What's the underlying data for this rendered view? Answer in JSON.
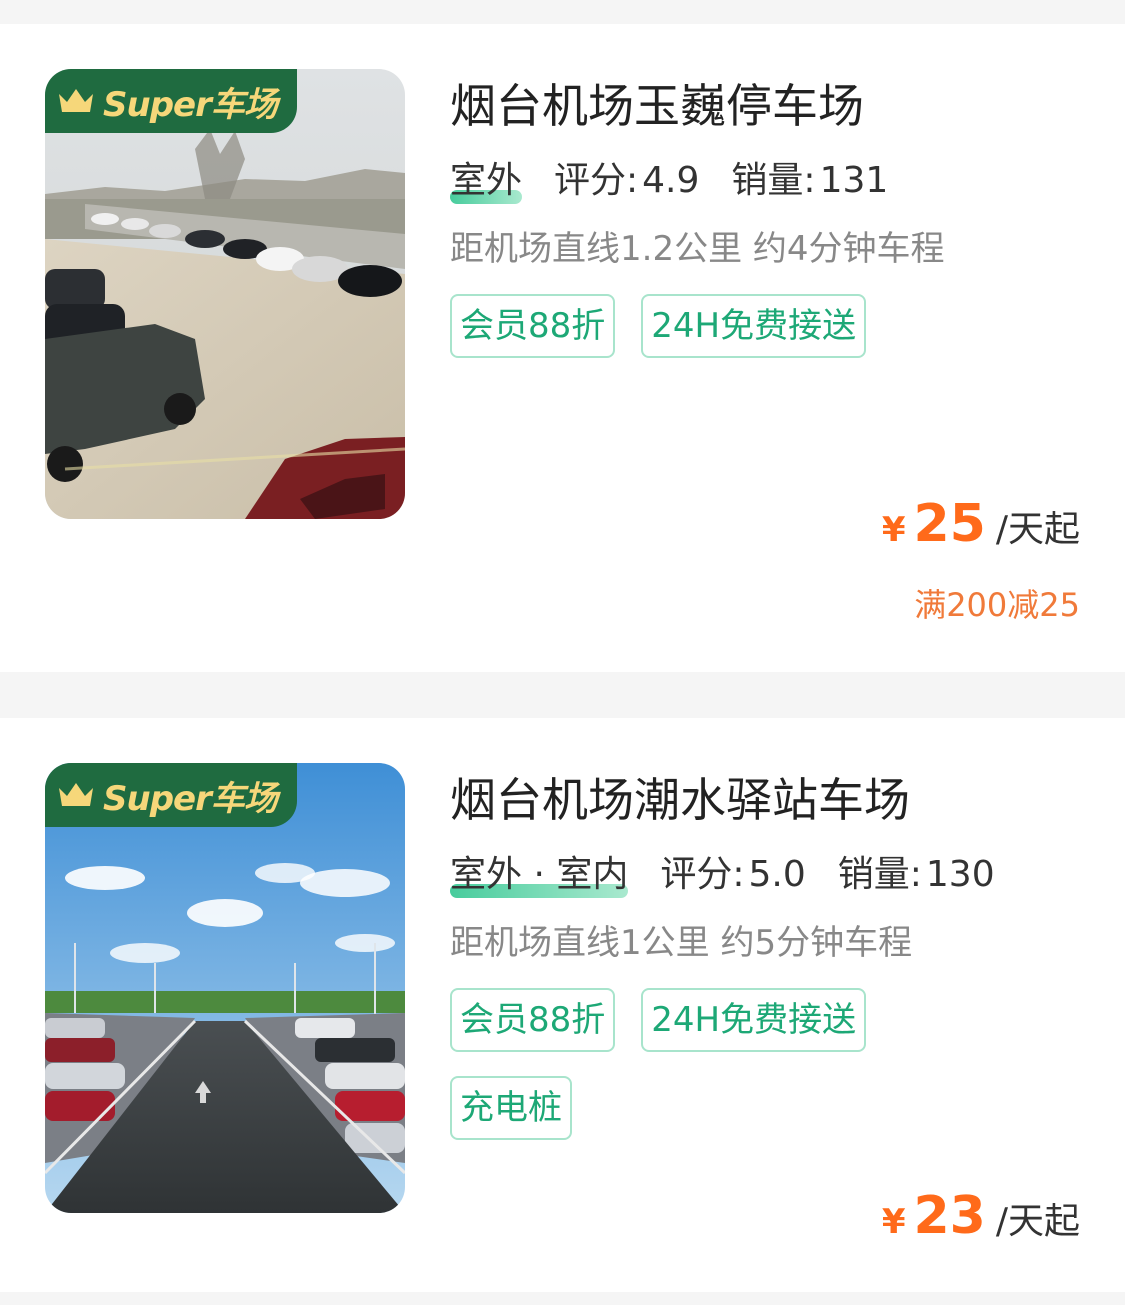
{
  "badge": {
    "text": "Super车场",
    "icon": "crown-icon"
  },
  "colors": {
    "accent_green": "#1da876",
    "price_orange": "#ff6a1a",
    "badge_bg": "#1f6b40",
    "badge_text": "#f6d77a"
  },
  "lots": [
    {
      "name": "烟台机场玉巍停车场",
      "type": "室外",
      "rating_label": "评分:",
      "rating": "4.9",
      "sales_label": "销量:",
      "sales": "131",
      "distance": "距机场直线1.2公里 约4分钟车程",
      "tags": [
        "会员88折",
        "24H免费接送"
      ],
      "price_symbol": "¥",
      "price": "25",
      "price_unit": "/天起",
      "discount": "满200减25"
    },
    {
      "name": "烟台机场潮水驿站车场",
      "type": "室外 · 室内",
      "rating_label": "评分:",
      "rating": "5.0",
      "sales_label": "销量:",
      "sales": "130",
      "distance": "距机场直线1公里 约5分钟车程",
      "tags": [
        "会员88折",
        "24H免费接送",
        "充电桩"
      ],
      "price_symbol": "¥",
      "price": "23",
      "price_unit": "/天起"
    }
  ]
}
